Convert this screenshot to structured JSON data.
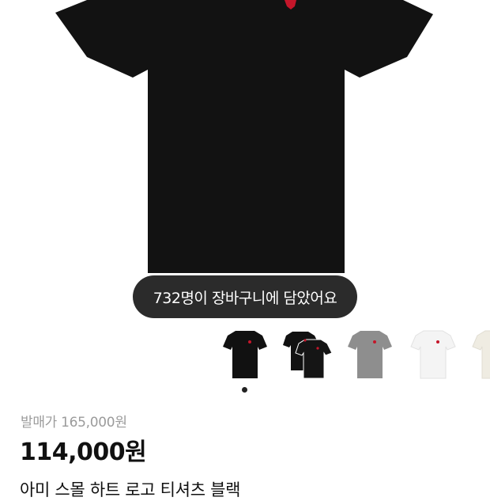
{
  "product": {
    "cart_notice": "732명이 장바구니에 담았어요",
    "original_price": "발매가 165,000원",
    "sale_price": "114,000원",
    "title": "아미 스몰 하트 로고 티셔츠 블랙"
  },
  "thumbnails": [
    {
      "color": "black",
      "selected": true
    },
    {
      "color": "black-2pack",
      "selected": false
    },
    {
      "color": "grey",
      "selected": false
    },
    {
      "color": "white",
      "selected": false
    },
    {
      "color": "ivory",
      "selected": false
    }
  ],
  "colors": {
    "pill_bg": "#2b2b2b",
    "shirt_black": "#121212",
    "logo_red": "#c4162a",
    "price_grey": "#9b9b9b"
  }
}
